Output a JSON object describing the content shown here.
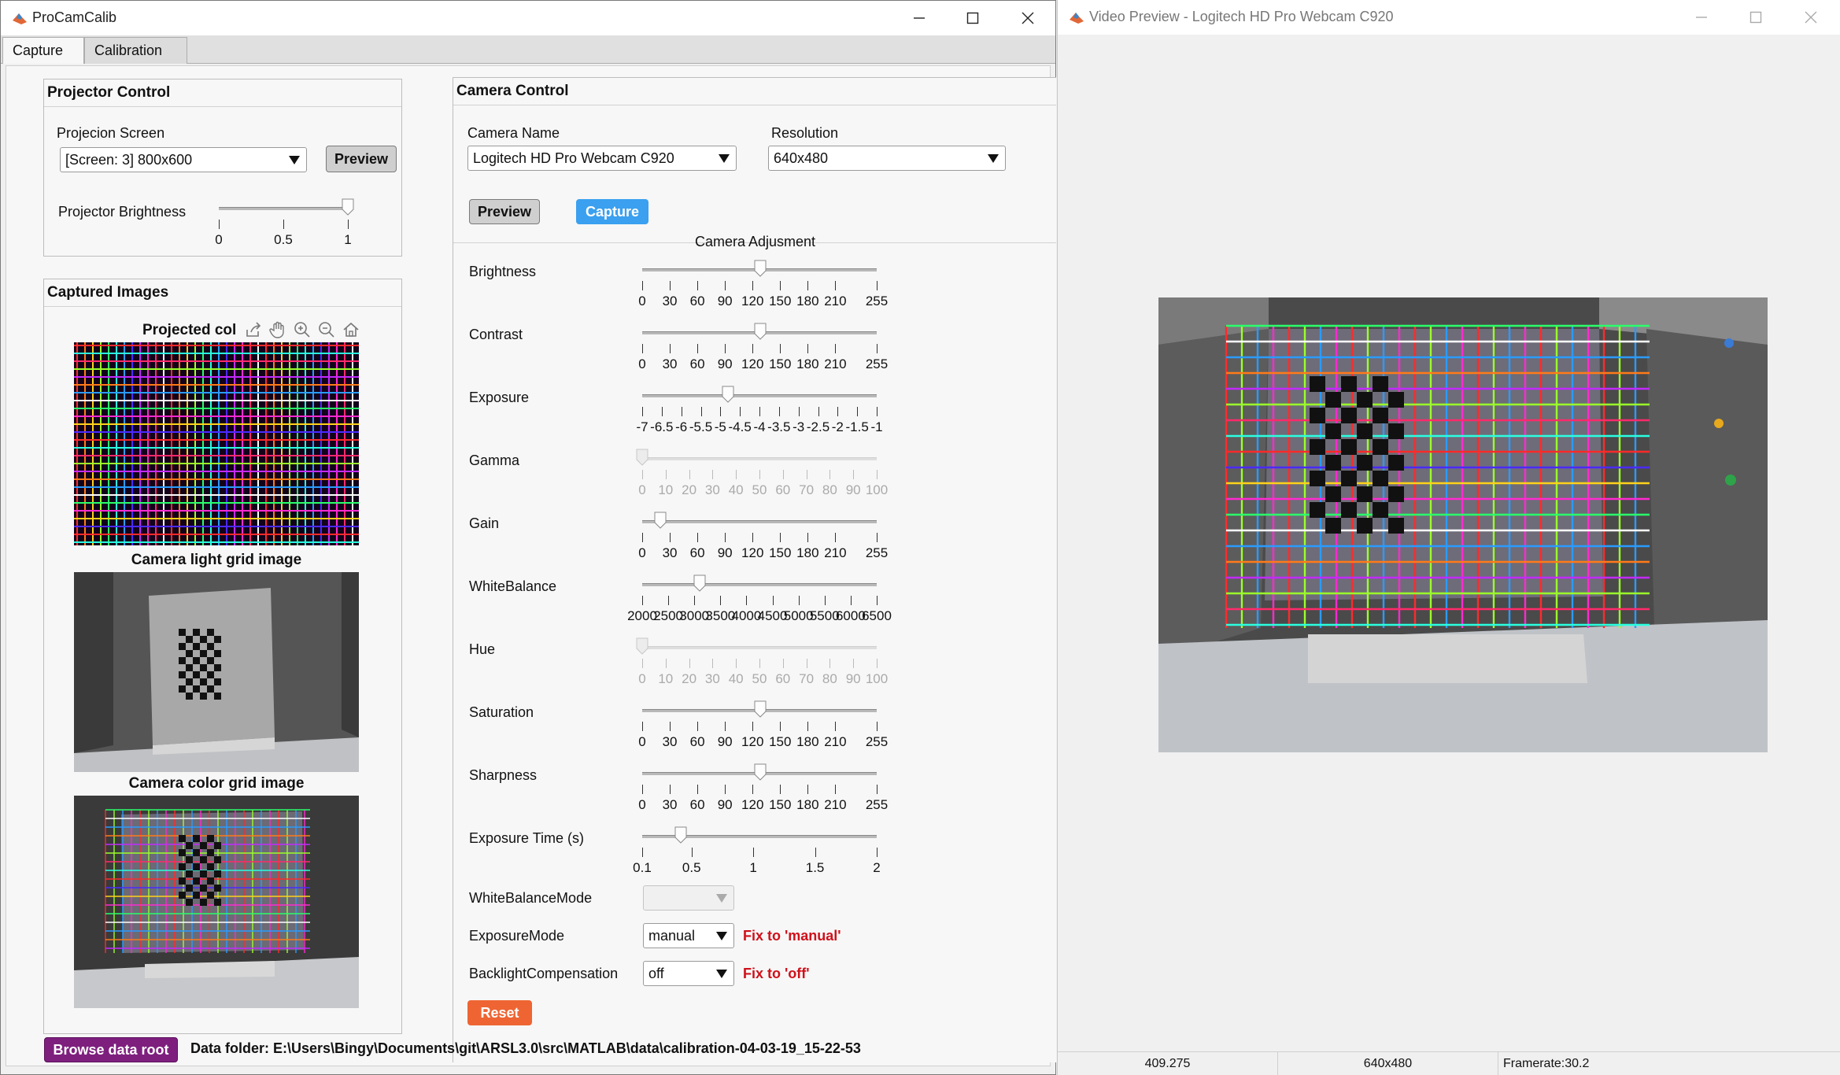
{
  "main_window": {
    "title": "ProCamCalib",
    "tabs": [
      "Capture",
      "Calibration"
    ]
  },
  "projector_control": {
    "title": "Projector Control",
    "screen_label": "Projecion Screen",
    "screen_value": "[Screen: 3] 800x600",
    "preview_label": "Preview",
    "brightness_label": "Projector Brightness",
    "brightness_value": 1,
    "brightness_ticks": [
      "0",
      "0.5",
      "1"
    ]
  },
  "captured_images": {
    "title": "Captured Images",
    "projected_caption": "Projected col",
    "camera_light_caption": "Camera light grid image",
    "camera_color_caption": "Camera color grid image"
  },
  "camera_control": {
    "title": "Camera Control",
    "camera_name_label": "Camera Name",
    "camera_name_value": "Logitech HD Pro Webcam C920",
    "resolution_label": "Resolution",
    "resolution_value": "640x480",
    "preview_label": "Preview",
    "capture_label": "Capture",
    "adjustment_title": "Camera Adjusment",
    "sliders": [
      {
        "label": "Brightness",
        "value": 128,
        "min": 0,
        "max": 255,
        "ticks": [
          "0",
          "30",
          "60",
          "90",
          "120",
          "150",
          "180",
          "210",
          "255"
        ],
        "enabled": true
      },
      {
        "label": "Contrast",
        "value": 128,
        "min": 0,
        "max": 255,
        "ticks": [
          "0",
          "30",
          "60",
          "90",
          "120",
          "150",
          "180",
          "210",
          "255"
        ],
        "enabled": true
      },
      {
        "label": "Exposure",
        "value": -4.8,
        "min": -7,
        "max": -1,
        "ticks": [
          "-7",
          "-6.5",
          "-6",
          "-5.5",
          "-5",
          "-4.5",
          "-4",
          "-3.5",
          "-3",
          "-2.5",
          "-2",
          "-1.5",
          "-1"
        ],
        "enabled": true
      },
      {
        "label": "Gamma",
        "value": 0,
        "min": 0,
        "max": 100,
        "ticks": [
          "0",
          "10",
          "20",
          "30",
          "40",
          "50",
          "60",
          "70",
          "80",
          "90",
          "100"
        ],
        "enabled": false
      },
      {
        "label": "Gain",
        "value": 20,
        "min": 0,
        "max": 255,
        "ticks": [
          "0",
          "30",
          "60",
          "90",
          "120",
          "150",
          "180",
          "210",
          "255"
        ],
        "enabled": true
      },
      {
        "label": "WhiteBalance",
        "value": 3100,
        "min": 2000,
        "max": 6500,
        "ticks": [
          "2000",
          "2500",
          "3000",
          "3500",
          "4000",
          "4500",
          "5000",
          "5500",
          "6000",
          "6500"
        ],
        "enabled": true
      },
      {
        "label": "Hue",
        "value": 0,
        "min": 0,
        "max": 100,
        "ticks": [
          "0",
          "10",
          "20",
          "30",
          "40",
          "50",
          "60",
          "70",
          "80",
          "90",
          "100"
        ],
        "enabled": false
      },
      {
        "label": "Saturation",
        "value": 128,
        "min": 0,
        "max": 255,
        "ticks": [
          "0",
          "30",
          "60",
          "90",
          "120",
          "150",
          "180",
          "210",
          "255"
        ],
        "enabled": true
      },
      {
        "label": "Sharpness",
        "value": 128,
        "min": 0,
        "max": 255,
        "ticks": [
          "0",
          "30",
          "60",
          "90",
          "120",
          "150",
          "180",
          "210",
          "255"
        ],
        "enabled": true
      },
      {
        "label": "Exposure Time (s)",
        "value": 0.41,
        "min": 0.1,
        "max": 2,
        "ticks": [
          "0.1",
          "0.5",
          "1",
          "1.5",
          "2"
        ],
        "enabled": true
      }
    ],
    "white_balance_mode_label": "WhiteBalanceMode",
    "white_balance_mode_value": "",
    "exposure_mode_label": "ExposureMode",
    "exposure_mode_value": "manual",
    "exposure_mode_note": "Fix to 'manual'",
    "backlight_label": "BacklightCompensation",
    "backlight_value": "off",
    "backlight_note": "Fix to 'off'",
    "reset_label": "Reset"
  },
  "footer": {
    "browse_label": "Browse data root",
    "data_folder": "Data folder: E:\\Users\\Bingy\\Documents\\git\\ARSL3.0\\src\\MATLAB\\data\\calibration-04-03-19_15-22-53"
  },
  "preview_window": {
    "title": "Video Preview - Logitech HD Pro Webcam C920",
    "status_time": "409.275",
    "status_resolution": "640x480",
    "status_framerate": "Framerate:30.2"
  },
  "colors": {
    "blue_button": "#3aa0ef",
    "orange_button": "#ee6533",
    "purple_button": "#7e1f7e",
    "error_text": "#d0101a"
  }
}
